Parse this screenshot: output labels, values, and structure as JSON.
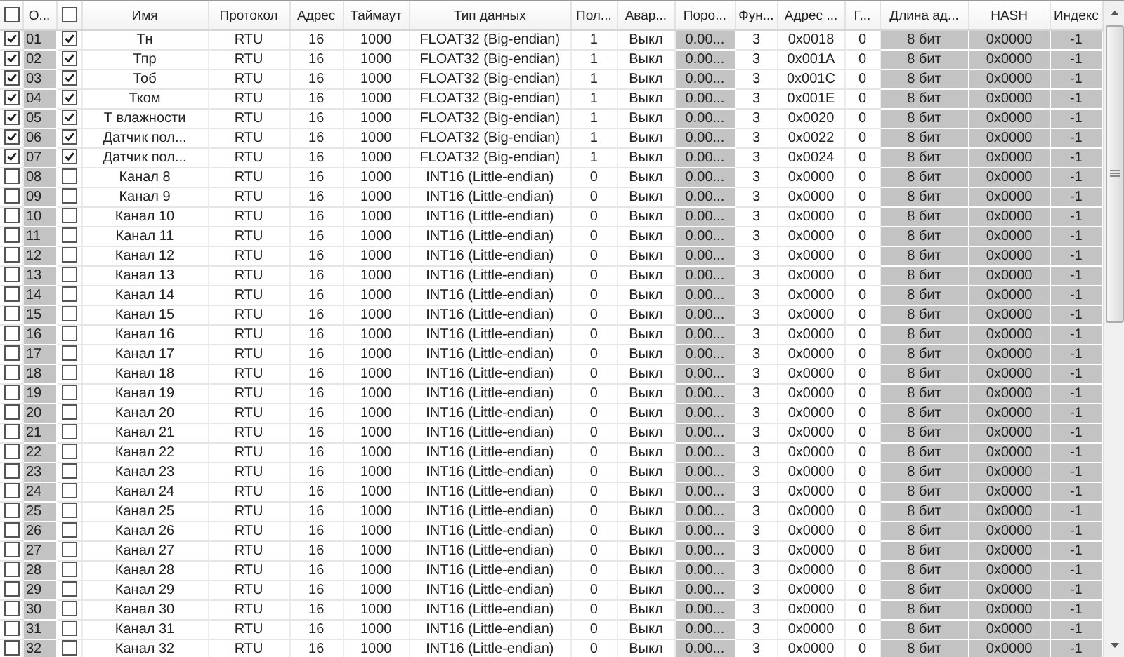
{
  "columns": [
    {
      "kind": "checkbox",
      "checked": false
    },
    {
      "kind": "text",
      "label": "О..."
    },
    {
      "kind": "checkbox",
      "checked": false
    },
    {
      "kind": "text",
      "label": "Имя"
    },
    {
      "kind": "text",
      "label": "Протокол"
    },
    {
      "kind": "text",
      "label": "Адрес"
    },
    {
      "kind": "text",
      "label": "Таймаут"
    },
    {
      "kind": "text",
      "label": "Тип данных"
    },
    {
      "kind": "text",
      "label": "Пол..."
    },
    {
      "kind": "text",
      "label": "Авар..."
    },
    {
      "kind": "text",
      "label": "Поро..."
    },
    {
      "kind": "text",
      "label": "Фун..."
    },
    {
      "kind": "text",
      "label": "Адрес ..."
    },
    {
      "kind": "text",
      "label": "Г..."
    },
    {
      "kind": "text",
      "label": "Длина ад..."
    },
    {
      "kind": "text",
      "label": "HASH"
    },
    {
      "kind": "text",
      "label": "Индекс"
    }
  ],
  "rows": [
    {
      "on": true,
      "num": "01",
      "active": true,
      "cells": [
        "Тн",
        "RTU",
        "16",
        "1000",
        "FLOAT32 (Big-endian)",
        "1",
        "Выкл",
        "0.00...",
        "3",
        "0x0018",
        "0",
        "8 бит",
        "0x0000",
        "-1"
      ]
    },
    {
      "on": true,
      "num": "02",
      "active": true,
      "cells": [
        "Тпр",
        "RTU",
        "16",
        "1000",
        "FLOAT32 (Big-endian)",
        "1",
        "Выкл",
        "0.00...",
        "3",
        "0x001A",
        "0",
        "8 бит",
        "0x0000",
        "-1"
      ]
    },
    {
      "on": true,
      "num": "03",
      "active": true,
      "cells": [
        "Тоб",
        "RTU",
        "16",
        "1000",
        "FLOAT32 (Big-endian)",
        "1",
        "Выкл",
        "0.00...",
        "3",
        "0x001C",
        "0",
        "8 бит",
        "0x0000",
        "-1"
      ]
    },
    {
      "on": true,
      "num": "04",
      "active": true,
      "cells": [
        "Тком",
        "RTU",
        "16",
        "1000",
        "FLOAT32 (Big-endian)",
        "1",
        "Выкл",
        "0.00...",
        "3",
        "0x001E",
        "0",
        "8 бит",
        "0x0000",
        "-1"
      ]
    },
    {
      "on": true,
      "num": "05",
      "active": true,
      "cells": [
        "Т влажности",
        "RTU",
        "16",
        "1000",
        "FLOAT32 (Big-endian)",
        "1",
        "Выкл",
        "0.00...",
        "3",
        "0x0020",
        "0",
        "8 бит",
        "0x0000",
        "-1"
      ]
    },
    {
      "on": true,
      "num": "06",
      "active": true,
      "cells": [
        "Датчик пол...",
        "RTU",
        "16",
        "1000",
        "FLOAT32 (Big-endian)",
        "1",
        "Выкл",
        "0.00...",
        "3",
        "0x0022",
        "0",
        "8 бит",
        "0x0000",
        "-1"
      ]
    },
    {
      "on": true,
      "num": "07",
      "active": true,
      "cells": [
        "Датчик пол...",
        "RTU",
        "16",
        "1000",
        "FLOAT32 (Big-endian)",
        "1",
        "Выкл",
        "0.00...",
        "3",
        "0x0024",
        "0",
        "8 бит",
        "0x0000",
        "-1"
      ]
    },
    {
      "on": false,
      "num": "08",
      "active": false,
      "cells": [
        "Канал 8",
        "RTU",
        "16",
        "1000",
        "INT16 (Little-endian)",
        "0",
        "Выкл",
        "0.00...",
        "3",
        "0x0000",
        "0",
        "8 бит",
        "0x0000",
        "-1"
      ]
    },
    {
      "on": false,
      "num": "09",
      "active": false,
      "cells": [
        "Канал 9",
        "RTU",
        "16",
        "1000",
        "INT16 (Little-endian)",
        "0",
        "Выкл",
        "0.00...",
        "3",
        "0x0000",
        "0",
        "8 бит",
        "0x0000",
        "-1"
      ]
    },
    {
      "on": false,
      "num": "10",
      "active": false,
      "cells": [
        "Канал 10",
        "RTU",
        "16",
        "1000",
        "INT16 (Little-endian)",
        "0",
        "Выкл",
        "0.00...",
        "3",
        "0x0000",
        "0",
        "8 бит",
        "0x0000",
        "-1"
      ]
    },
    {
      "on": false,
      "num": "11",
      "active": false,
      "cells": [
        "Канал 11",
        "RTU",
        "16",
        "1000",
        "INT16 (Little-endian)",
        "0",
        "Выкл",
        "0.00...",
        "3",
        "0x0000",
        "0",
        "8 бит",
        "0x0000",
        "-1"
      ]
    },
    {
      "on": false,
      "num": "12",
      "active": false,
      "cells": [
        "Канал 12",
        "RTU",
        "16",
        "1000",
        "INT16 (Little-endian)",
        "0",
        "Выкл",
        "0.00...",
        "3",
        "0x0000",
        "0",
        "8 бит",
        "0x0000",
        "-1"
      ]
    },
    {
      "on": false,
      "num": "13",
      "active": false,
      "cells": [
        "Канал 13",
        "RTU",
        "16",
        "1000",
        "INT16 (Little-endian)",
        "0",
        "Выкл",
        "0.00...",
        "3",
        "0x0000",
        "0",
        "8 бит",
        "0x0000",
        "-1"
      ]
    },
    {
      "on": false,
      "num": "14",
      "active": false,
      "cells": [
        "Канал 14",
        "RTU",
        "16",
        "1000",
        "INT16 (Little-endian)",
        "0",
        "Выкл",
        "0.00...",
        "3",
        "0x0000",
        "0",
        "8 бит",
        "0x0000",
        "-1"
      ]
    },
    {
      "on": false,
      "num": "15",
      "active": false,
      "cells": [
        "Канал 15",
        "RTU",
        "16",
        "1000",
        "INT16 (Little-endian)",
        "0",
        "Выкл",
        "0.00...",
        "3",
        "0x0000",
        "0",
        "8 бит",
        "0x0000",
        "-1"
      ]
    },
    {
      "on": false,
      "num": "16",
      "active": false,
      "cells": [
        "Канал 16",
        "RTU",
        "16",
        "1000",
        "INT16 (Little-endian)",
        "0",
        "Выкл",
        "0.00...",
        "3",
        "0x0000",
        "0",
        "8 бит",
        "0x0000",
        "-1"
      ]
    },
    {
      "on": false,
      "num": "17",
      "active": false,
      "cells": [
        "Канал 17",
        "RTU",
        "16",
        "1000",
        "INT16 (Little-endian)",
        "0",
        "Выкл",
        "0.00...",
        "3",
        "0x0000",
        "0",
        "8 бит",
        "0x0000",
        "-1"
      ]
    },
    {
      "on": false,
      "num": "18",
      "active": false,
      "cells": [
        "Канал 18",
        "RTU",
        "16",
        "1000",
        "INT16 (Little-endian)",
        "0",
        "Выкл",
        "0.00...",
        "3",
        "0x0000",
        "0",
        "8 бит",
        "0x0000",
        "-1"
      ]
    },
    {
      "on": false,
      "num": "19",
      "active": false,
      "cells": [
        "Канал 19",
        "RTU",
        "16",
        "1000",
        "INT16 (Little-endian)",
        "0",
        "Выкл",
        "0.00...",
        "3",
        "0x0000",
        "0",
        "8 бит",
        "0x0000",
        "-1"
      ]
    },
    {
      "on": false,
      "num": "20",
      "active": false,
      "cells": [
        "Канал 20",
        "RTU",
        "16",
        "1000",
        "INT16 (Little-endian)",
        "0",
        "Выкл",
        "0.00...",
        "3",
        "0x0000",
        "0",
        "8 бит",
        "0x0000",
        "-1"
      ]
    },
    {
      "on": false,
      "num": "21",
      "active": false,
      "cells": [
        "Канал 21",
        "RTU",
        "16",
        "1000",
        "INT16 (Little-endian)",
        "0",
        "Выкл",
        "0.00...",
        "3",
        "0x0000",
        "0",
        "8 бит",
        "0x0000",
        "-1"
      ]
    },
    {
      "on": false,
      "num": "22",
      "active": false,
      "cells": [
        "Канал 22",
        "RTU",
        "16",
        "1000",
        "INT16 (Little-endian)",
        "0",
        "Выкл",
        "0.00...",
        "3",
        "0x0000",
        "0",
        "8 бит",
        "0x0000",
        "-1"
      ]
    },
    {
      "on": false,
      "num": "23",
      "active": false,
      "cells": [
        "Канал 23",
        "RTU",
        "16",
        "1000",
        "INT16 (Little-endian)",
        "0",
        "Выкл",
        "0.00...",
        "3",
        "0x0000",
        "0",
        "8 бит",
        "0x0000",
        "-1"
      ]
    },
    {
      "on": false,
      "num": "24",
      "active": false,
      "cells": [
        "Канал 24",
        "RTU",
        "16",
        "1000",
        "INT16 (Little-endian)",
        "0",
        "Выкл",
        "0.00...",
        "3",
        "0x0000",
        "0",
        "8 бит",
        "0x0000",
        "-1"
      ]
    },
    {
      "on": false,
      "num": "25",
      "active": false,
      "cells": [
        "Канал 25",
        "RTU",
        "16",
        "1000",
        "INT16 (Little-endian)",
        "0",
        "Выкл",
        "0.00...",
        "3",
        "0x0000",
        "0",
        "8 бит",
        "0x0000",
        "-1"
      ]
    },
    {
      "on": false,
      "num": "26",
      "active": false,
      "cells": [
        "Канал 26",
        "RTU",
        "16",
        "1000",
        "INT16 (Little-endian)",
        "0",
        "Выкл",
        "0.00...",
        "3",
        "0x0000",
        "0",
        "8 бит",
        "0x0000",
        "-1"
      ]
    },
    {
      "on": false,
      "num": "27",
      "active": false,
      "cells": [
        "Канал 27",
        "RTU",
        "16",
        "1000",
        "INT16 (Little-endian)",
        "0",
        "Выкл",
        "0.00...",
        "3",
        "0x0000",
        "0",
        "8 бит",
        "0x0000",
        "-1"
      ]
    },
    {
      "on": false,
      "num": "28",
      "active": false,
      "cells": [
        "Канал 28",
        "RTU",
        "16",
        "1000",
        "INT16 (Little-endian)",
        "0",
        "Выкл",
        "0.00...",
        "3",
        "0x0000",
        "0",
        "8 бит",
        "0x0000",
        "-1"
      ]
    },
    {
      "on": false,
      "num": "29",
      "active": false,
      "cells": [
        "Канал 29",
        "RTU",
        "16",
        "1000",
        "INT16 (Little-endian)",
        "0",
        "Выкл",
        "0.00...",
        "3",
        "0x0000",
        "0",
        "8 бит",
        "0x0000",
        "-1"
      ]
    },
    {
      "on": false,
      "num": "30",
      "active": false,
      "cells": [
        "Канал 30",
        "RTU",
        "16",
        "1000",
        "INT16 (Little-endian)",
        "0",
        "Выкл",
        "0.00...",
        "3",
        "0x0000",
        "0",
        "8 бит",
        "0x0000",
        "-1"
      ]
    },
    {
      "on": false,
      "num": "31",
      "active": false,
      "cells": [
        "Канал 31",
        "RTU",
        "16",
        "1000",
        "INT16 (Little-endian)",
        "0",
        "Выкл",
        "0.00...",
        "3",
        "0x0000",
        "0",
        "8 бит",
        "0x0000",
        "-1"
      ]
    },
    {
      "on": false,
      "num": "32",
      "active": false,
      "cells": [
        "Канал 32",
        "RTU",
        "16",
        "1000",
        "INT16 (Little-endian)",
        "0",
        "Выкл",
        "0.00...",
        "3",
        "0x0000",
        "0",
        "8 бит",
        "0x0000",
        "-1"
      ]
    }
  ]
}
